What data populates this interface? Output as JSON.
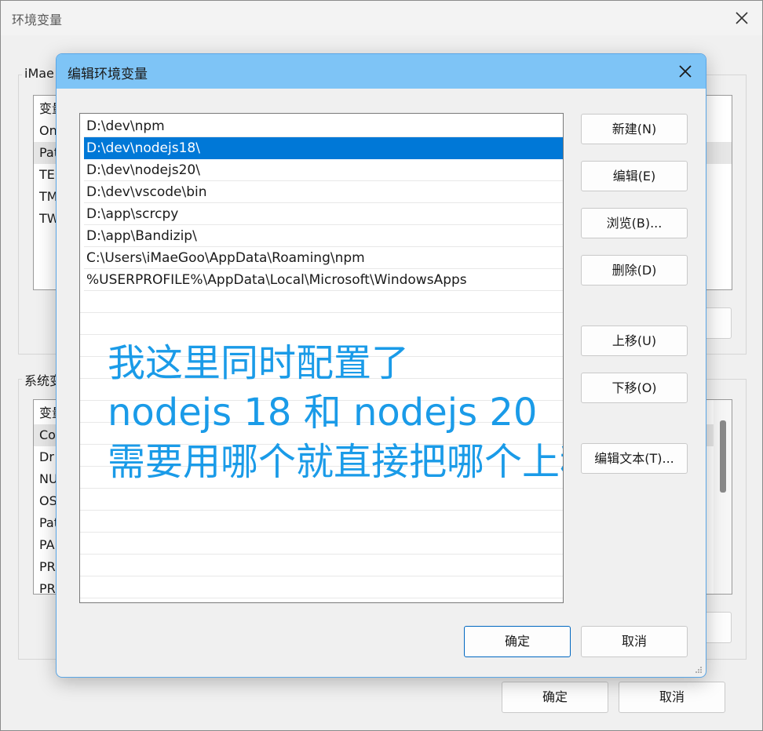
{
  "outer_window": {
    "title": "环境变量",
    "user_group_label": "iMae",
    "user_vars": [
      "变量",
      "On",
      "Pat",
      "TEI",
      "TM",
      "TW"
    ],
    "system_group_label": "系统变",
    "system_vars": [
      "变量",
      "Co",
      "Dr",
      "NU",
      "OS",
      "Pat",
      "PA",
      "PR",
      "PR"
    ],
    "ok_label": "确定",
    "cancel_label": "取消"
  },
  "dialog": {
    "title": "编辑环境变量",
    "paths": [
      "D:\\dev\\npm",
      "D:\\dev\\nodejs18\\",
      "D:\\dev\\nodejs20\\",
      "D:\\dev\\vscode\\bin",
      "D:\\app\\scrcpy",
      "D:\\app\\Bandizip\\",
      "C:\\Users\\iMaeGoo\\AppData\\Roaming\\npm",
      "%USERPROFILE%\\AppData\\Local\\Microsoft\\WindowsApps"
    ],
    "selected_index": 1,
    "buttons": {
      "new": "新建(N)",
      "edit": "编辑(E)",
      "browse": "浏览(B)...",
      "delete": "删除(D)",
      "move_up": "上移(U)",
      "move_down": "下移(O)",
      "edit_text": "编辑文本(T)..."
    },
    "ok_label": "确定",
    "cancel_label": "取消"
  },
  "annotation": {
    "line1": "我这里同时配置了",
    "line2": "nodejs 18 和 nodejs 20",
    "line3": "需要用哪个就直接把哪个上移"
  },
  "colors": {
    "dialog_title_bg": "#7ec4f6",
    "selection": "#0078d7",
    "annotation": "#1a9be8",
    "primary_border": "#0067c0"
  }
}
